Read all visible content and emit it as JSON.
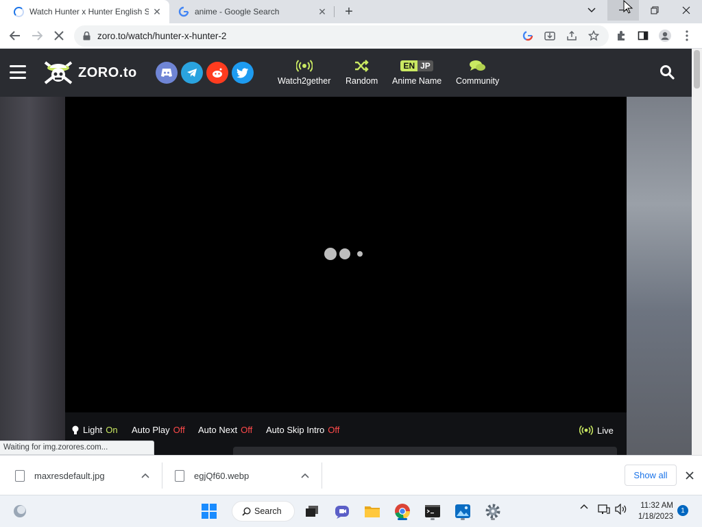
{
  "browser": {
    "tabs": [
      {
        "title": "Watch Hunter x Hunter English S",
        "active": true
      },
      {
        "title": "anime - Google Search",
        "active": false
      }
    ],
    "url": "zoro.to/watch/hunter-x-hunter-2",
    "status_text": "Waiting for img.zorores.com..."
  },
  "site": {
    "logo_text": "ZORO.to",
    "social": [
      "discord-icon",
      "telegram-icon",
      "reddit-icon",
      "twitter-icon"
    ],
    "nav": {
      "watch2gether": "Watch2gether",
      "random": "Random",
      "anime_name": "Anime Name",
      "community": "Community",
      "lang_en": "EN",
      "lang_jp": "JP"
    },
    "accent_color": "#cae962"
  },
  "player": {
    "controls": {
      "light_label": "Light",
      "light_value": "On",
      "autoplay_label": "Auto Play",
      "autoplay_value": "Off",
      "autonext_label": "Auto Next",
      "autonext_value": "Off",
      "autoskip_label": "Auto Skip Intro",
      "autoskip_value": "Off",
      "live_label": "Live"
    }
  },
  "downloads": {
    "items": [
      {
        "name": "maxresdefault.jpg"
      },
      {
        "name": "egjQf60.webp"
      }
    ],
    "show_all": "Show all"
  },
  "taskbar": {
    "search_label": "Search",
    "time": "11:32 AM",
    "date": "1/18/2023",
    "notification_count": "1"
  }
}
